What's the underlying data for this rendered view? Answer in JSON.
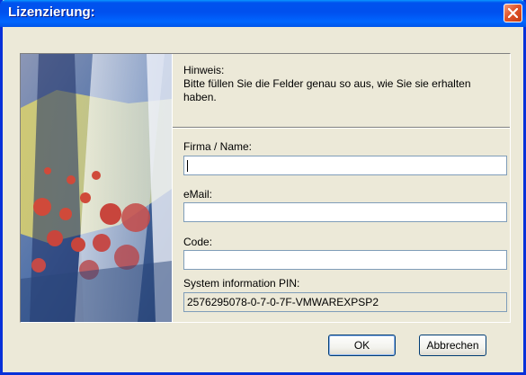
{
  "window": {
    "title": "Lizenzierung:"
  },
  "note": {
    "title": "Hinweis:",
    "body": "Bitte füllen Sie die Felder genau so aus, wie Sie sie erhalten haben."
  },
  "fields": {
    "company": {
      "label": "Firma / Name:",
      "value": ""
    },
    "email": {
      "label": "eMail:",
      "value": ""
    },
    "code": {
      "label": "Code:",
      "value": ""
    },
    "pin": {
      "label": "System information PIN:",
      "value": "2576295078-0-7-0-7F-VMWAREXPSP2"
    }
  },
  "buttons": {
    "ok": "OK",
    "cancel": "Abbrechen"
  },
  "colors": {
    "titlebar": "#0055e8",
    "close": "#e2542a",
    "dialog_bg": "#ece9d8"
  }
}
